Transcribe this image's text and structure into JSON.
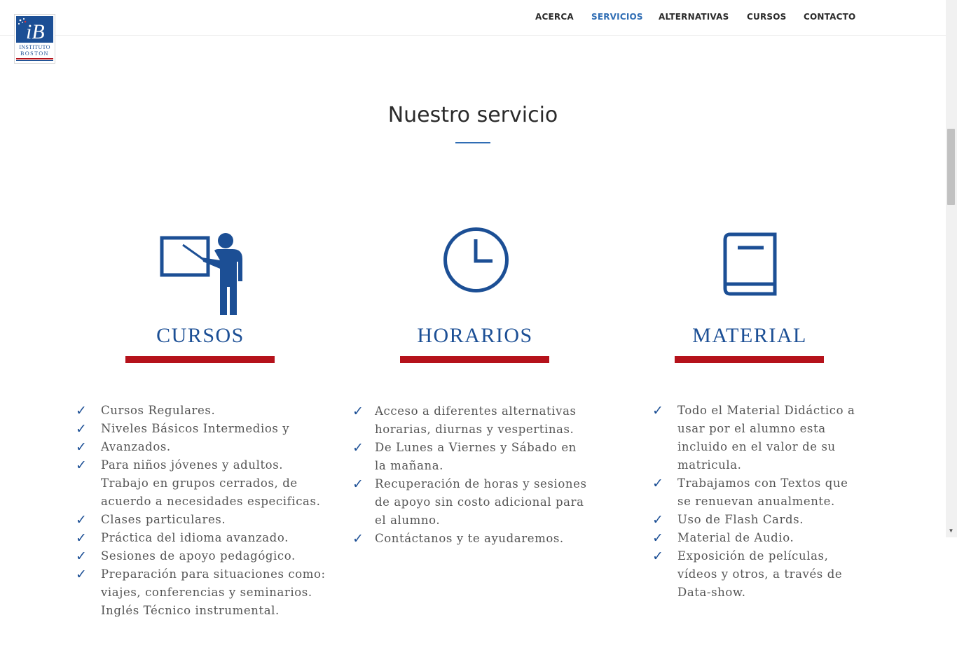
{
  "logo": {
    "monogram": "iB",
    "line1": "INSTITUTO",
    "line2": "BOSTON"
  },
  "nav": {
    "items": [
      {
        "label": "ACERCA",
        "active": false
      },
      {
        "label": "SERVICIOS",
        "active": true
      },
      {
        "label": "ALTERNATIVAS",
        "active": false
      },
      {
        "label": "CURSOS",
        "active": false
      },
      {
        "label": "CONTACTO",
        "active": false
      }
    ]
  },
  "section": {
    "title": "Nuestro servicio"
  },
  "colors": {
    "primary_blue": "#1c4f95",
    "accent_red": "#b5121b",
    "nav_active": "#2f6db4"
  },
  "columns": [
    {
      "icon": "teacher-icon",
      "heading": "CURSOS",
      "items": [
        "Cursos Regulares.",
        "Niveles Básicos Intermedios y",
        "Avanzados.",
        "Para niños jóvenes y adultos.",
        "Trabajo en grupos cerrados, de acuerdo a necesidades especificas.",
        "Clases particulares.",
        "Práctica del idioma avanzado.",
        "Sesiones de apoyo pedagógico.",
        "Preparación para situaciones como: viajes, conferencias y seminarios.",
        "Inglés Técnico instrumental."
      ]
    },
    {
      "icon": "clock-icon",
      "heading": "HORARIOS",
      "items": [
        "Acceso a diferentes alternativas horarias, diurnas y vespertinas.",
        "De Lunes a Viernes y Sábado en la mañana.",
        "Recuperación de horas y sesiones de apoyo sin costo adicional para el alumno.",
        "Contáctanos y te ayudaremos."
      ]
    },
    {
      "icon": "book-icon",
      "heading": "MATERIAL",
      "items": [
        "Todo el Material Didáctico a usar por el alumno esta incluido en el valor de su matricula.",
        "Trabajamos con Textos que se renuevan anualmente.",
        "Uso de Flash Cards.",
        "Material de Audio.",
        "Exposición de películas, vídeos y otros, a través de Data-show."
      ]
    }
  ]
}
